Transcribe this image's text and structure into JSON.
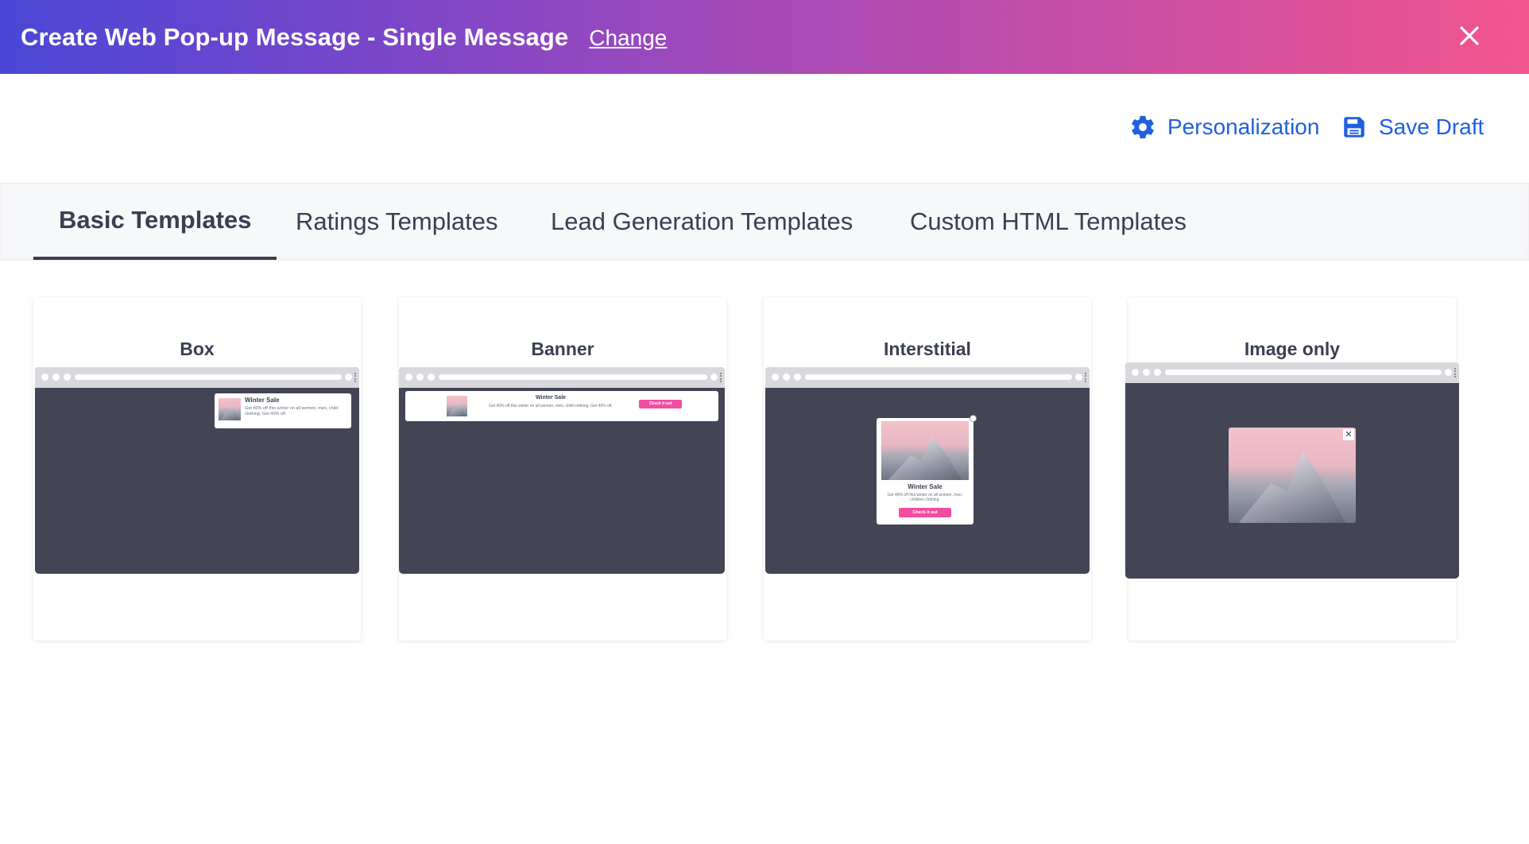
{
  "header": {
    "title": "Create Web Pop-up Message - Single Message",
    "change_label": "Change"
  },
  "toolbar": {
    "personalization_label": "Personalization",
    "save_draft_label": "Save Draft"
  },
  "tabs": [
    {
      "label": "Basic Templates",
      "active": true
    },
    {
      "label": "Ratings Templates",
      "active": false
    },
    {
      "label": "Lead Generation Templates",
      "active": false
    },
    {
      "label": "Custom HTML Templates",
      "active": false
    }
  ],
  "templates": [
    {
      "name": "Box",
      "preview": {
        "title": "Winter Sale",
        "text": "Get 40% off this winter on all women, men, child clothing. Get 40% off."
      }
    },
    {
      "name": "Banner",
      "preview": {
        "title": "Winter Sale",
        "text": "Get 40% off this winter on all women, men, child clothing. Get 40% off.",
        "button": "Check it out"
      }
    },
    {
      "name": "Interstitial",
      "preview": {
        "title": "Winter Sale",
        "text": "Get 40% off this winter on all women, men, children clothing.",
        "button": "Check it out"
      }
    },
    {
      "name": "Image only",
      "preview": {}
    }
  ],
  "colors": {
    "header_gradient_start": "#4a47d6",
    "header_gradient_end": "#f2558e",
    "link_blue": "#1f5fe0",
    "preview_dark": "#434555",
    "cta_pink": "#f24da0"
  }
}
